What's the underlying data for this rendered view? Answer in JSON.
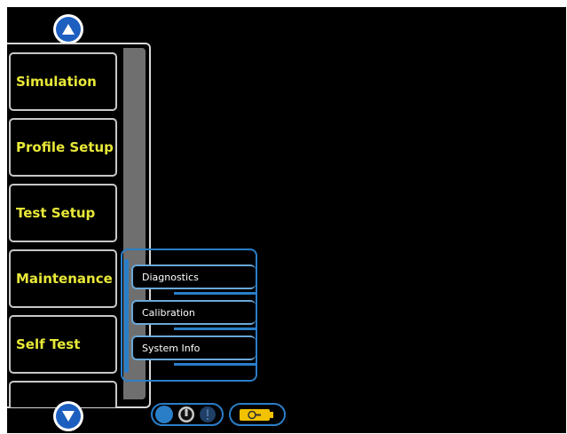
{
  "menu": {
    "items": [
      {
        "label": "Simulation"
      },
      {
        "label": "Profile Setup"
      },
      {
        "label": "Test Setup"
      },
      {
        "label": "Maintenance"
      },
      {
        "label": "Self Test"
      },
      {
        "label": ""
      }
    ]
  },
  "submenu": {
    "items": [
      {
        "label": "Diagnostics"
      },
      {
        "label": "Calibration"
      },
      {
        "label": "System Info"
      }
    ]
  },
  "icons": {
    "scroll_up": "up-arrow-icon",
    "scroll_down": "down-arrow-icon",
    "remote_status": "remote-lock-icon",
    "alert": "alert-icon",
    "battery": "battery-icon"
  },
  "colors": {
    "menu_text": "#e8e838",
    "accent_blue": "#2a7ec8",
    "battery_yellow": "#f2c200"
  }
}
